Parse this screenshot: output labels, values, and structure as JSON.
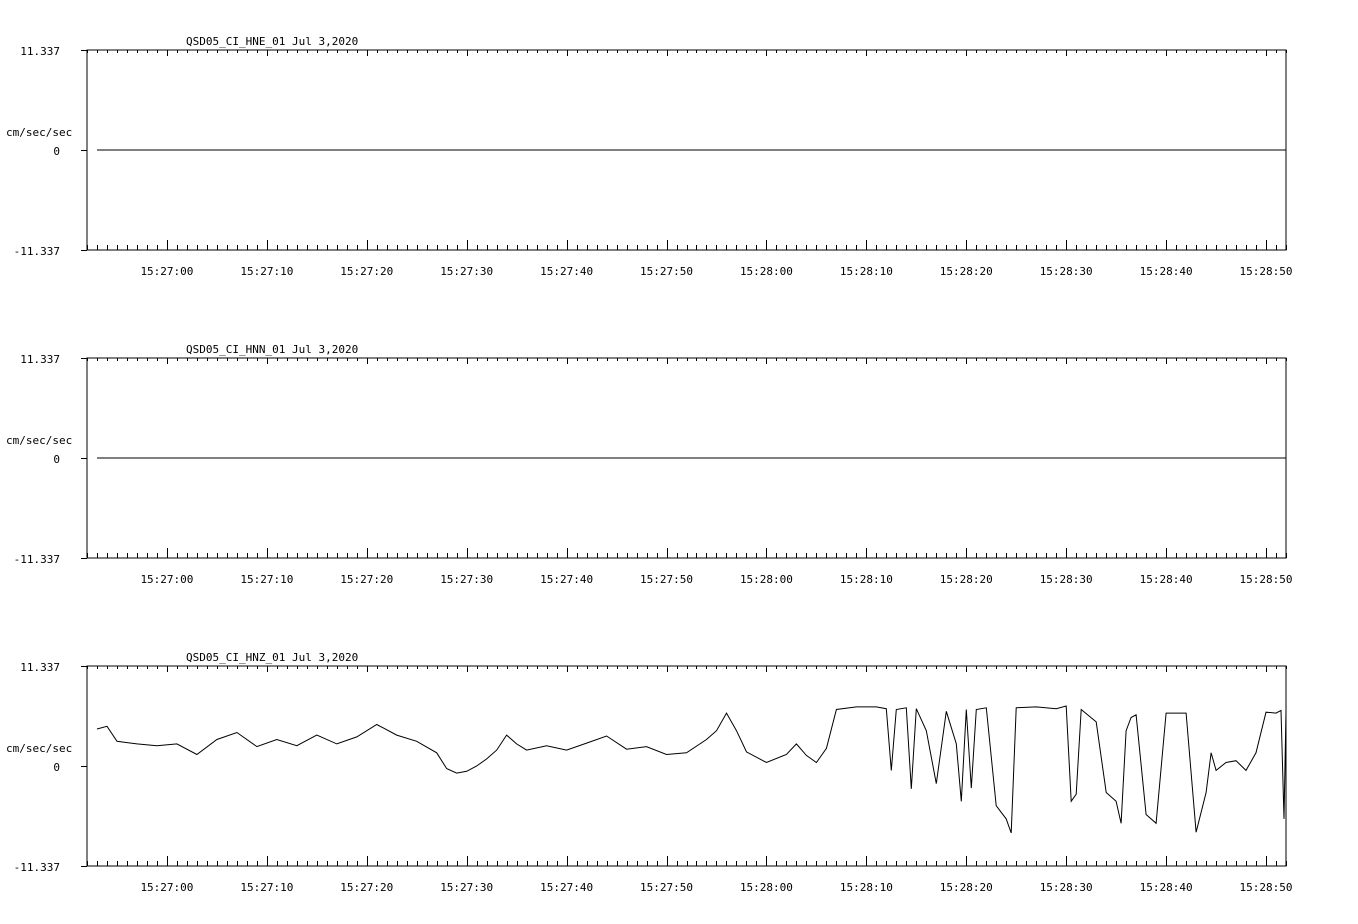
{
  "chart_data": [
    {
      "type": "line",
      "title": "QSD05_CI_HNE_01  Jul 3,2020",
      "ylabel": "cm/sec/sec",
      "ylim": [
        -11.337,
        11.337
      ],
      "ytick_labels": [
        "11.337",
        "0",
        "-11.337"
      ],
      "xlim": [
        "15:26:52",
        "15:28:52"
      ],
      "xtick_labels": [
        "15:27:00",
        "15:27:10",
        "15:27:20",
        "15:27:30",
        "15:27:40",
        "15:27:50",
        "15:28:00",
        "15:28:10",
        "15:28:20",
        "15:28:30",
        "15:28:40",
        "15:28:50"
      ],
      "series": [
        {
          "points": [
            [
              "15:26:53",
              0.0
            ],
            [
              "15:28:52",
              0.0
            ]
          ]
        }
      ]
    },
    {
      "type": "line",
      "title": "QSD05_CI_HNN_01  Jul 3,2020",
      "ylabel": "cm/sec/sec",
      "ylim": [
        -11.337,
        11.337
      ],
      "ytick_labels": [
        "11.337",
        "0",
        "-11.337"
      ],
      "xlim": [
        "15:26:52",
        "15:28:52"
      ],
      "xtick_labels": [
        "15:27:00",
        "15:27:10",
        "15:27:20",
        "15:27:30",
        "15:27:40",
        "15:27:50",
        "15:28:00",
        "15:28:10",
        "15:28:20",
        "15:28:30",
        "15:28:40",
        "15:28:50"
      ],
      "series": [
        {
          "points": [
            [
              "15:26:53",
              0.0
            ],
            [
              "15:28:52",
              0.0
            ]
          ]
        }
      ]
    },
    {
      "type": "line",
      "title": "QSD05_CI_HNZ_01  Jul 3,2020",
      "ylabel": "cm/sec/sec",
      "ylim": [
        -11.337,
        11.337
      ],
      "ytick_labels": [
        "11.337",
        "0",
        "-11.337"
      ],
      "xlim": [
        "15:26:52",
        "15:28:52"
      ],
      "xtick_labels": [
        "15:27:00",
        "15:27:10",
        "15:27:20",
        "15:27:30",
        "15:27:40",
        "15:27:50",
        "15:28:00",
        "15:28:10",
        "15:28:20",
        "15:28:30",
        "15:28:40",
        "15:28:50"
      ],
      "series": [
        {
          "points": [
            [
              "15:26:53",
              4.2
            ],
            [
              "15:26:54",
              4.5
            ],
            [
              "15:26:55",
              2.8
            ],
            [
              "15:26:57",
              2.5
            ],
            [
              "15:26:59",
              2.3
            ],
            [
              "15:27:01",
              2.5
            ],
            [
              "15:27:03",
              1.3
            ],
            [
              "15:27:05",
              3.0
            ],
            [
              "15:27:07",
              3.8
            ],
            [
              "15:27:09",
              2.2
            ],
            [
              "15:27:11",
              3.0
            ],
            [
              "15:27:13",
              2.3
            ],
            [
              "15:27:15",
              3.5
            ],
            [
              "15:27:17",
              2.5
            ],
            [
              "15:27:19",
              3.3
            ],
            [
              "15:27:21",
              4.7
            ],
            [
              "15:27:23",
              3.5
            ],
            [
              "15:27:25",
              2.8
            ],
            [
              "15:27:27",
              1.5
            ],
            [
              "15:27:28",
              -0.3
            ],
            [
              "15:27:29",
              -0.8
            ],
            [
              "15:27:30",
              -0.6
            ],
            [
              "15:27:31",
              0.0
            ],
            [
              "15:27:32",
              0.8
            ],
            [
              "15:27:33",
              1.8
            ],
            [
              "15:27:34",
              3.5
            ],
            [
              "15:27:35",
              2.5
            ],
            [
              "15:27:36",
              1.8
            ],
            [
              "15:27:38",
              2.3
            ],
            [
              "15:27:40",
              1.8
            ],
            [
              "15:27:42",
              2.6
            ],
            [
              "15:27:44",
              3.4
            ],
            [
              "15:27:46",
              1.9
            ],
            [
              "15:27:48",
              2.2
            ],
            [
              "15:27:50",
              1.3
            ],
            [
              "15:27:52",
              1.5
            ],
            [
              "15:27:54",
              3.0
            ],
            [
              "15:27:55",
              4.0
            ],
            [
              "15:27:56",
              6.0
            ],
            [
              "15:27:57",
              4.0
            ],
            [
              "15:27:58",
              1.6
            ],
            [
              "15:28:00",
              0.4
            ],
            [
              "15:28:02",
              1.3
            ],
            [
              "15:28:03",
              2.5
            ],
            [
              "15:28:04",
              1.2
            ],
            [
              "15:28:05",
              0.4
            ],
            [
              "15:28:06",
              2.0
            ],
            [
              "15:28:07",
              6.4
            ],
            [
              "15:28:09",
              6.7
            ],
            [
              "15:28:11",
              6.7
            ],
            [
              "15:28:12",
              6.5
            ],
            [
              "15:28:12.5",
              -0.5
            ],
            [
              "15:28:13",
              6.4
            ],
            [
              "15:28:14",
              6.6
            ],
            [
              "15:28:14.5",
              -2.6
            ],
            [
              "15:28:15",
              6.5
            ],
            [
              "15:28:16",
              4.0
            ],
            [
              "15:28:17",
              -2.0
            ],
            [
              "15:28:18",
              6.2
            ],
            [
              "15:28:19",
              2.5
            ],
            [
              "15:28:19.5",
              -4.0
            ],
            [
              "15:28:20",
              6.4
            ],
            [
              "15:28:20.5",
              -2.5
            ],
            [
              "15:28:21",
              6.4
            ],
            [
              "15:28:22",
              6.6
            ],
            [
              "15:28:23",
              -4.5
            ],
            [
              "15:28:24",
              -6.0
            ],
            [
              "15:28:24.5",
              -7.6
            ],
            [
              "15:28:25",
              6.6
            ],
            [
              "15:28:27",
              6.7
            ],
            [
              "15:28:29",
              6.5
            ],
            [
              "15:28:30",
              6.8
            ],
            [
              "15:28:30.5",
              -4.0
            ],
            [
              "15:28:31",
              -3.2
            ],
            [
              "15:28:31.5",
              6.4
            ],
            [
              "15:28:33",
              5.0
            ],
            [
              "15:28:34",
              -3.0
            ],
            [
              "15:28:35",
              -4.0
            ],
            [
              "15:28:35.5",
              -6.5
            ],
            [
              "15:28:36",
              4.0
            ],
            [
              "15:28:36.5",
              5.5
            ],
            [
              "15:28:37",
              5.8
            ],
            [
              "15:28:38",
              -5.5
            ],
            [
              "15:28:39",
              -6.5
            ],
            [
              "15:28:40",
              6.0
            ],
            [
              "15:28:42",
              6.0
            ],
            [
              "15:28:43",
              -7.5
            ],
            [
              "15:28:44",
              -3.0
            ],
            [
              "15:28:44.5",
              1.5
            ],
            [
              "15:28:45",
              -0.5
            ],
            [
              "15:28:46",
              0.4
            ],
            [
              "15:28:47",
              0.6
            ],
            [
              "15:28:48",
              -0.5
            ],
            [
              "15:28:49",
              1.5
            ],
            [
              "15:28:50",
              6.1
            ],
            [
              "15:28:51",
              6.0
            ],
            [
              "15:28:51.5",
              6.3
            ],
            [
              "15:28:51.8",
              -6.0
            ],
            [
              "15:28:52",
              6.2
            ]
          ]
        }
      ]
    }
  ]
}
